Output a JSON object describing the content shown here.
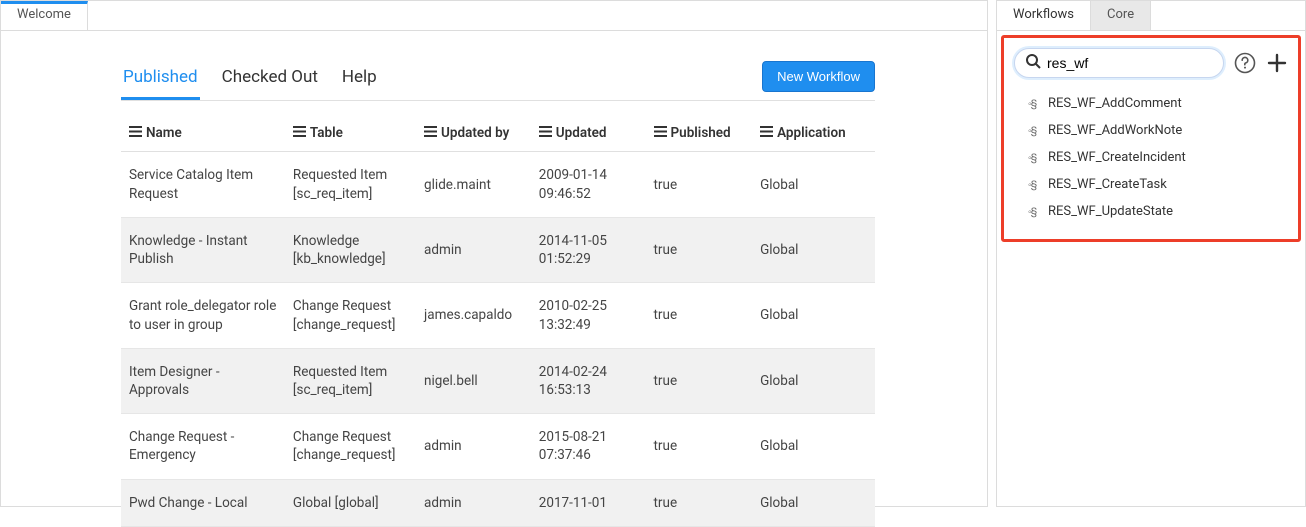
{
  "left_tabs": {
    "welcome": "Welcome"
  },
  "section_tabs": {
    "published": "Published",
    "checked_out": "Checked Out",
    "help": "Help"
  },
  "new_workflow_btn": "New Workflow",
  "columns": {
    "name": "Name",
    "table": "Table",
    "updated_by": "Updated by",
    "updated": "Updated",
    "published": "Published",
    "application": "Application"
  },
  "rows": [
    {
      "name_l1": "Service Catalog Item",
      "name_l2": "Request",
      "table_l1": "Requested Item",
      "table_l2": "[sc_req_item]",
      "updated_by": "glide.maint",
      "updated_l1": "2009-01-14",
      "updated_l2": "09:46:52",
      "published": "true",
      "application": "Global"
    },
    {
      "name_l1": "Knowledge - Instant",
      "name_l2": "Publish",
      "table_l1": "Knowledge",
      "table_l2": "[kb_knowledge]",
      "updated_by": "admin",
      "updated_l1": "2014-11-05",
      "updated_l2": "01:52:29",
      "published": "true",
      "application": "Global"
    },
    {
      "name_l1": "Grant role_delegator role",
      "name_l2": "to user in group",
      "table_l1": "Change Request",
      "table_l2": "[change_request]",
      "updated_by": "james.capaldo",
      "updated_l1": "2010-02-25",
      "updated_l2": "13:32:49",
      "published": "true",
      "application": "Global"
    },
    {
      "name_l1": "Item Designer - Approvals",
      "name_l2": "",
      "table_l1": "Requested Item",
      "table_l2": "[sc_req_item]",
      "updated_by": "nigel.bell",
      "updated_l1": "2014-02-24",
      "updated_l2": "16:53:13",
      "published": "true",
      "application": "Global"
    },
    {
      "name_l1": "Change Request -",
      "name_l2": "Emergency",
      "table_l1": "Change Request",
      "table_l2": "[change_request]",
      "updated_by": "admin",
      "updated_l1": "2015-08-21",
      "updated_l2": "07:37:46",
      "published": "true",
      "application": "Global"
    },
    {
      "name_l1": "Pwd Change - Local",
      "name_l2": "",
      "table_l1": "Global [global]",
      "table_l2": "",
      "updated_by": "admin",
      "updated_l1": "2017-11-01",
      "updated_l2": "",
      "published": "true",
      "application": "Global"
    }
  ],
  "right_tabs": {
    "workflows": "Workflows",
    "core": "Core"
  },
  "search": {
    "value": "res_wf"
  },
  "results": [
    "RES_WF_AddComment",
    "RES_WF_AddWorkNote",
    "RES_WF_CreateIncident",
    "RES_WF_CreateTask",
    "RES_WF_UpdateState"
  ]
}
